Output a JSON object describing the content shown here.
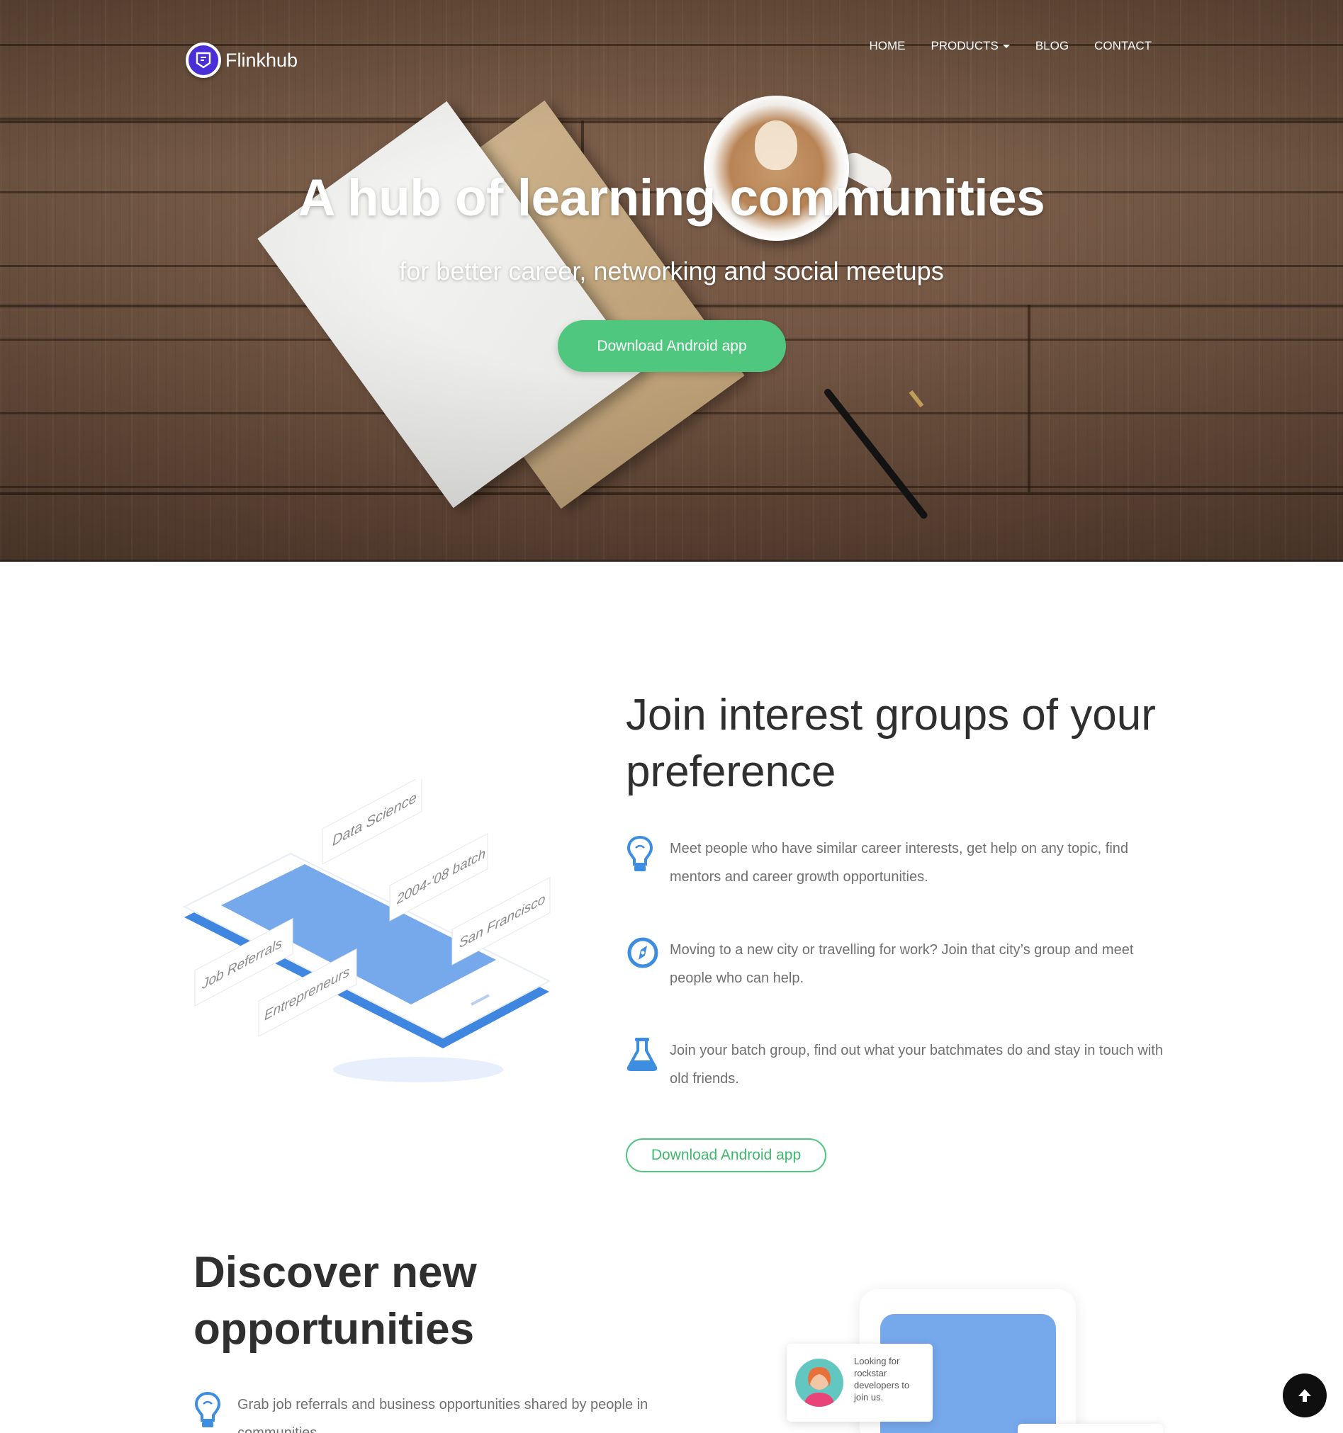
{
  "brand": {
    "name": "Flinkhub",
    "logo_icon": "chat-bubble-icon",
    "accent": "#4a2fd6"
  },
  "nav": {
    "items": [
      {
        "label": "HOME"
      },
      {
        "label": "PRODUCTS",
        "has_dropdown": true
      },
      {
        "label": "BLOG"
      },
      {
        "label": "CONTACT"
      }
    ]
  },
  "hero": {
    "title": "A hub of learning communities",
    "subtitle": "for better career, networking and social meetups",
    "cta_label": "Download Android app",
    "cta_color": "#4fc77e"
  },
  "groups_section": {
    "title": "Join interest groups of your preference",
    "illustration_tags": [
      "Data Science",
      "2004-'08 batch",
      "San Francisco",
      "Job Referrals",
      "Entrepreneurs"
    ],
    "features": [
      {
        "icon": "lightbulb-icon",
        "text": "Meet people who have similar career interests, get help on any topic, find mentors and career growth opportunities."
      },
      {
        "icon": "compass-icon",
        "text": "Moving to a new city or travelling for work? Join that city’s group and meet people who can help."
      },
      {
        "icon": "flask-icon",
        "text": "Join your batch group, find out what your batchmates do and stay in touch with old friends."
      }
    ],
    "cta_label": "Download Android app",
    "icon_color": "#3d8de0"
  },
  "opportunities_section": {
    "title": "Discover new opportunities",
    "features": [
      {
        "icon": "lightbulb-icon",
        "text": "Grab job referrals and business opportunities shared by people in communities."
      }
    ],
    "chat_bubble_text": "Looking for rockstar developers to join us."
  },
  "scroll_top": {
    "icon": "arrow-up-icon"
  }
}
